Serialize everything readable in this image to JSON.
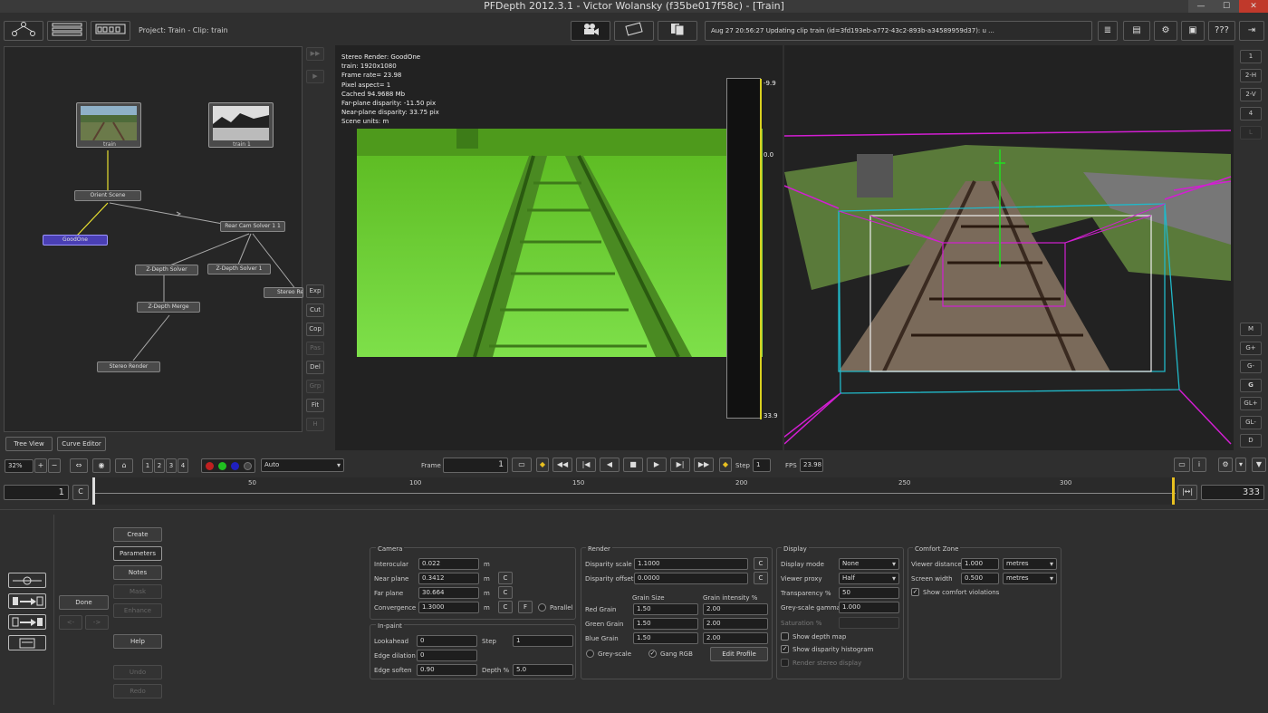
{
  "window": {
    "title": "PFDepth 2012.3.1 - Victor Wolansky (f35be017f58c) - [Train]",
    "minimize": "—",
    "maximize": "☐",
    "close": "✕"
  },
  "toolbar": {
    "project_label": "Project: Train - Clip: train",
    "status_message": "Aug 27 20:56:27 Updating clip train (id=3fd193eb-a772-43c2-893b-a34589959d37): u ...",
    "help_label": "???"
  },
  "tree": {
    "nodes": [
      "train",
      "train 1",
      "Orient Scene",
      "GoodOne",
      "Rear Cam Solver 1 1",
      "Z-Depth Solver",
      "Z-Depth Solver 1",
      "Stereo Re",
      "Z-Depth Merge",
      "Stereo Render"
    ],
    "tabs": [
      "Tree View",
      "Curve Editor"
    ],
    "side_buttons": [
      "Exp",
      "Cut",
      "Cop",
      "Pas",
      "Del",
      "Grp",
      "Fit",
      "H"
    ]
  },
  "viewer_info": [
    "Stereo Render: GoodOne",
    "train: 1920x1080",
    "Frame rate= 23.98",
    "Pixel aspect= 1",
    "Cached 94.9688 Mb",
    "Far-plane disparity: -11.50 pix",
    "Near-plane disparity: 33.75 pix",
    "Scene units: m"
  ],
  "histogram_labels": {
    "top": "-9.9",
    "zero": "0.0",
    "bottom": "33.9"
  },
  "right_buttons": [
    "1",
    "2-H",
    "2-V",
    "4",
    "L",
    "M",
    "G+",
    "G-",
    "G",
    "GL+",
    "GL-",
    "D"
  ],
  "playback": {
    "zoom": "32%",
    "view_slots": [
      "1",
      "2",
      "3",
      "4"
    ],
    "channel_mode": "Auto",
    "frame_label": "Frame",
    "frame_value": "1",
    "step_label": "Step",
    "step_value": "1",
    "fps_label": "FPS",
    "fps_value": "23.98"
  },
  "timeline": {
    "start": "1",
    "c_button": "C",
    "ticks": [
      "50",
      "100",
      "150",
      "200",
      "250",
      "300"
    ],
    "end": "333"
  },
  "side_panel": {
    "done": "Done",
    "buttons": [
      "Create",
      "Parameters",
      "Notes",
      "Mask",
      "Enhance",
      "Help",
      "Undo",
      "Redo"
    ],
    "nav": [
      "<-",
      "->"
    ]
  },
  "camera": {
    "title": "Camera",
    "interocular_label": "Interocular",
    "interocular": "0.022",
    "interocular_unit": "m",
    "near_label": "Near plane",
    "near": "0.3412",
    "near_unit": "m",
    "near_c": "C",
    "far_label": "Far plane",
    "far": "30.664",
    "far_unit": "m",
    "far_c": "C",
    "conv_label": "Convergence",
    "conv": "1.3000",
    "conv_unit": "m",
    "conv_c": "C",
    "conv_f": "F",
    "parallel_label": "Parallel"
  },
  "inpaint": {
    "title": "In-paint",
    "lookahead_label": "Lookahead",
    "lookahead": "0",
    "step_label": "Step",
    "step": "1",
    "dilation_label": "Edge dilation",
    "dilation": "0",
    "soften_label": "Edge soften",
    "soften": "0.90",
    "depth_label": "Depth %",
    "depth": "5.0"
  },
  "render": {
    "title": "Render",
    "disp_scale_label": "Disparity scale",
    "disp_scale": "1.1000",
    "disp_scale_c": "C",
    "disp_offset_label": "Disparity offset",
    "disp_offset": "0.0000",
    "disp_offset_c": "C",
    "grain_size_label": "Grain Size",
    "grain_int_label": "Grain intensity %",
    "red_label": "Red Grain",
    "red_size": "1.50",
    "red_int": "2.00",
    "green_label": "Green Grain",
    "green_size": "1.50",
    "green_int": "2.00",
    "blue_label": "Blue Grain",
    "blue_size": "1.50",
    "blue_int": "2.00",
    "greyscale_label": "Grey-scale",
    "gang_label": "Gang RGB",
    "edit_profile": "Edit Profile"
  },
  "display": {
    "title": "Display",
    "mode_label": "Display mode",
    "mode": "None",
    "proxy_label": "Viewer proxy",
    "proxy": "Half",
    "transp_label": "Transparency %",
    "transp": "50",
    "gamma_label": "Grey-scale gamma",
    "gamma": "1.000",
    "saturation_label": "Saturation %",
    "saturation": "",
    "depth_map_label": "Show depth map",
    "histogram_label": "Show disparity histogram",
    "stereo_label": "Render stereo display"
  },
  "comfort": {
    "title": "Comfort Zone",
    "viewer_dist_label": "Viewer distance",
    "viewer_dist": "1.000",
    "viewer_dist_unit": "metres",
    "screen_width_label": "Screen width",
    "screen_width": "0.500",
    "screen_width_unit": "metres",
    "violations_label": "Show comfort violations"
  },
  "colors": {
    "accent_node": "#4a3fb5",
    "green_overlay": "#5fd42a",
    "magenta": "#d21ed2",
    "cyan": "#21b8c8"
  }
}
